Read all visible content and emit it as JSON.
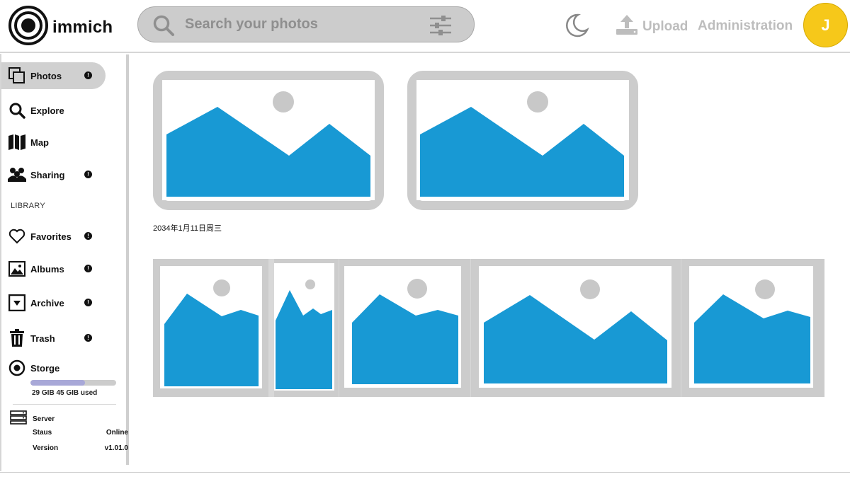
{
  "header": {
    "app_name": "immich",
    "search_placeholder": "Search your photos",
    "upload_label": "Upload",
    "admin_label": "Administration",
    "avatar_initial": "J"
  },
  "sidebar": {
    "items": [
      {
        "label": "Photos",
        "icon": "photos-icon",
        "badge": "!"
      },
      {
        "label": "Explore",
        "icon": "search-icon"
      },
      {
        "label": "Map",
        "icon": "map-icon"
      },
      {
        "label": "Sharing",
        "icon": "people-icon",
        "badge": "!"
      }
    ],
    "library_title": "LIBRARY",
    "library_items": [
      {
        "label": "Favorites",
        "icon": "heart-icon",
        "badge": "!"
      },
      {
        "label": "Albums",
        "icon": "image-icon",
        "badge": "!"
      },
      {
        "label": "Archive",
        "icon": "archive-icon",
        "badge": "!"
      },
      {
        "label": "Trash",
        "icon": "trash-icon",
        "badge": "!"
      }
    ],
    "storage": {
      "label": "Storge",
      "used_text": "29 GIB 45 GIB used",
      "used_fraction": 0.64
    },
    "server": {
      "label": "Server",
      "status_label": "Staus",
      "status_value": "Online",
      "version_label": "Version",
      "version_value": "v1.01.0"
    }
  },
  "main": {
    "date_label": "2034年1月11日周三"
  },
  "colors": {
    "accent": "#1899d4",
    "frame": "#cccccc",
    "avatar": "#f6c81a"
  }
}
